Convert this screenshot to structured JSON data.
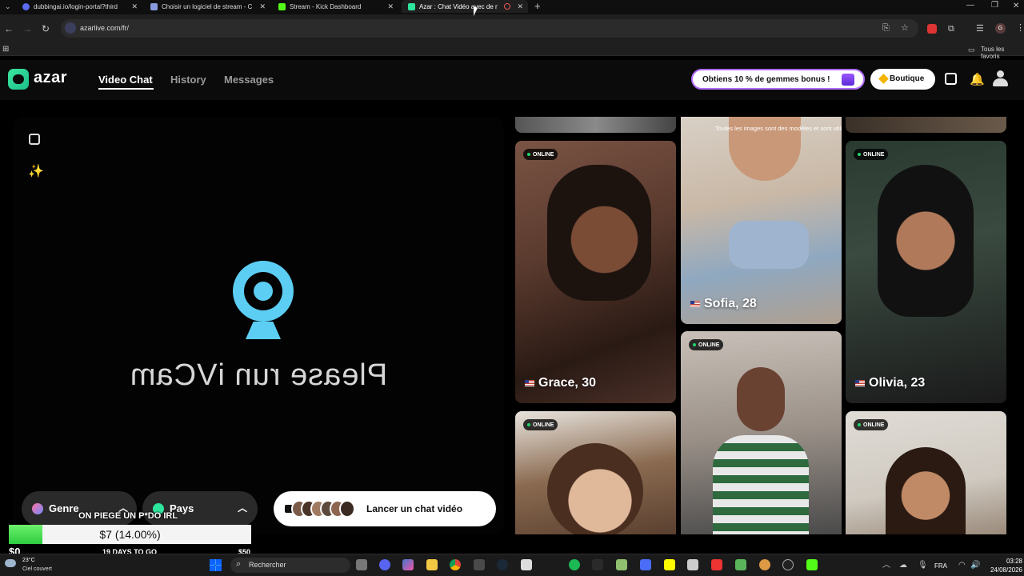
{
  "browser": {
    "tabs": [
      {
        "title": "dubbingai.io/login-portal?third",
        "color": "#5a6df0"
      },
      {
        "title": "Choisir un logiciel de stream - C",
        "color": "#8899dd"
      },
      {
        "title": "Stream - Kick Dashboard",
        "color": "#53fc18"
      },
      {
        "title": "Azar : Chat Vidéo avec de n",
        "color": "#2ee59d"
      }
    ],
    "url": "azarlive.com/fr/",
    "bookmarks_label": "Tous les favoris"
  },
  "site": {
    "logo": "azar",
    "nav": [
      "Video Chat",
      "History",
      "Messages"
    ],
    "promo": "Obtiens 10 % de gemmes bonus !",
    "shop": "Boutique"
  },
  "video": {
    "camera_message": "Please run iVCam",
    "filters": [
      "Genre",
      "Pays"
    ],
    "launch_label": "Lancer un chat vidéo"
  },
  "gallery": {
    "disclaimer": "Toutes les images sont des modèles et sont utilisées à des fins d'illustration uniquement.",
    "online_label": "ONLINE",
    "cards": [
      {
        "name": "Grace, 30",
        "online": true
      },
      {
        "name": "Sofia, 28",
        "online": false
      },
      {
        "name": "Olivia, 23",
        "online": true
      }
    ]
  },
  "overlay": {
    "title": "ON PIEGE UN P*DO IRL",
    "progress_text": "$7 (14.00%)",
    "progress": 0.14,
    "start": "$0",
    "countdown": "19 DAYS TO GO",
    "goal": "$50"
  },
  "taskbar": {
    "weather_temp": "23°C",
    "weather_desc": "Ciel couvert",
    "search": "Rechercher",
    "language": "FRA",
    "time": "03:28",
    "date": "24/08/2026"
  }
}
